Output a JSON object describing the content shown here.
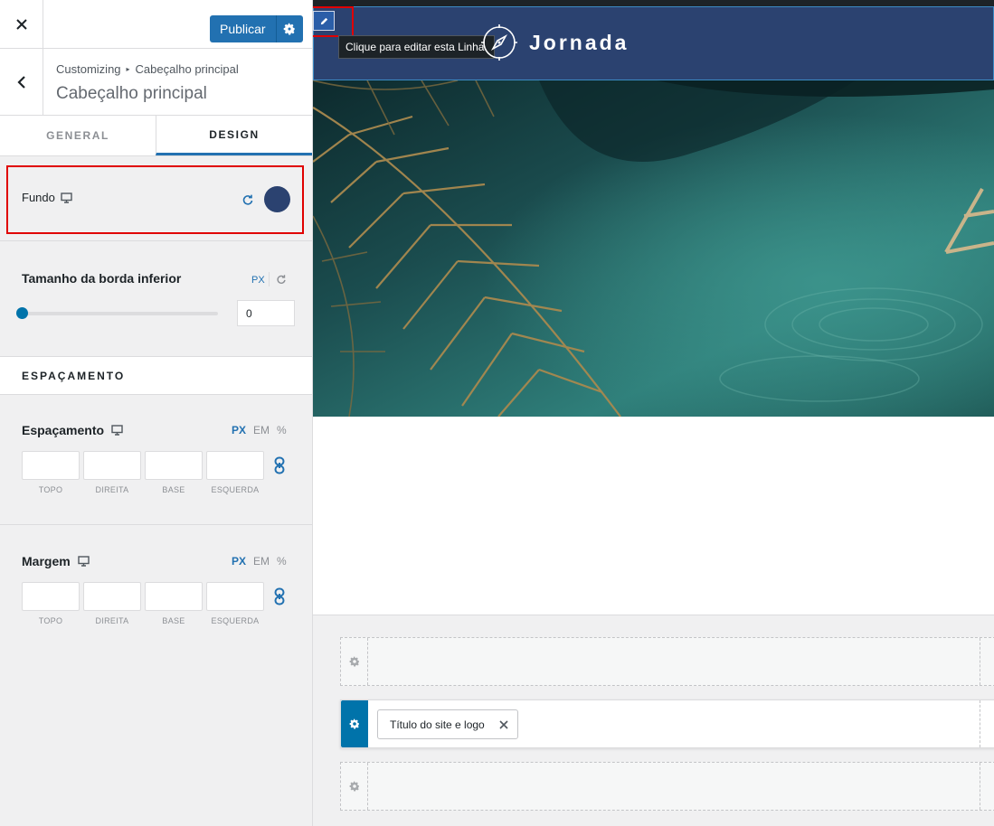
{
  "topbar": {
    "publish_label": "Publicar"
  },
  "section": {
    "breadcrumb_root": "Customizing",
    "breadcrumb_sep": "▸",
    "breadcrumb_current": "Cabeçalho principal",
    "title": "Cabeçalho principal"
  },
  "tabs": [
    {
      "label": "GENERAL",
      "active": false
    },
    {
      "label": "DESIGN",
      "active": true
    }
  ],
  "fundo": {
    "label": "Fundo",
    "color": "#2b4270"
  },
  "border": {
    "label": "Tamanho da borda inferior",
    "unit": "PX",
    "value": "0",
    "slider_value": 0
  },
  "spacing_section": {
    "title": "ESPAÇAMENTO"
  },
  "padding": {
    "label": "Espaçamento",
    "units": [
      "PX",
      "EM",
      "%"
    ],
    "active_unit": "PX",
    "sides": [
      "TOPO",
      "DIREITA",
      "BASE",
      "ESQUERDA"
    ]
  },
  "margin": {
    "label": "Margem",
    "units": [
      "PX",
      "EM",
      "%"
    ],
    "active_unit": "PX",
    "sides": [
      "TOPO",
      "DIREITA",
      "BASE",
      "ESQUERDA"
    ]
  },
  "preview": {
    "tooltip": "Clique para editar esta Linha.",
    "site_title": "Jornada",
    "header_color": "#2b4270"
  },
  "builder": {
    "chip_label": "Título do site e logo"
  },
  "colors": {
    "accent": "#2271b1",
    "highlight": "#e00000",
    "header": "#2b4270"
  }
}
